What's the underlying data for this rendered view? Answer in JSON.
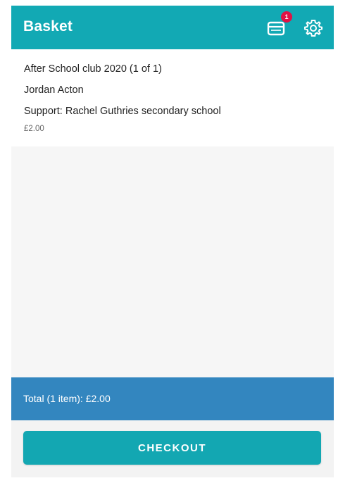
{
  "appbar": {
    "title": "Basket",
    "basket_icon": "basket-icon",
    "basket_badge_count": "1",
    "settings_icon": "gear-icon"
  },
  "basket": {
    "items": [
      {
        "title": "After School club 2020 (1 of 1)",
        "attendee": "Jordan Acton",
        "support": "Support: Rachel Guthries secondary school",
        "price": "£2.00"
      }
    ]
  },
  "summary": {
    "total_label": "Total (1 item): £2.00"
  },
  "checkout": {
    "label": "CHECKOUT"
  },
  "colors": {
    "primary": "#12a9b4",
    "total_bar": "#3386bf",
    "badge": "#e01245"
  }
}
